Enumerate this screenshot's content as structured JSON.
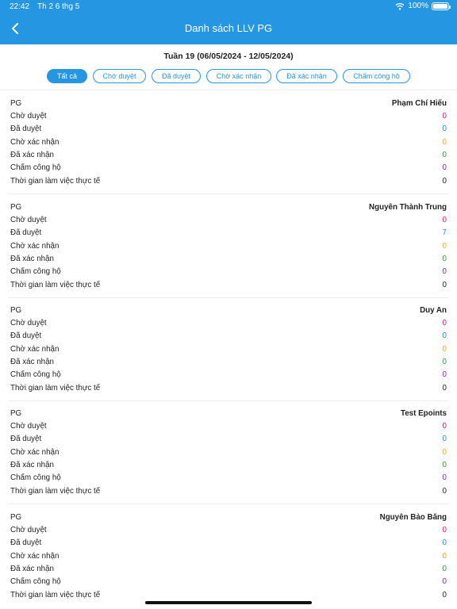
{
  "status_bar": {
    "time": "22:42",
    "date": "Th 2 6 thg 5",
    "battery": "100%"
  },
  "header": {
    "title": "Danh sách LLV PG",
    "back_icon": "chevron-left-icon"
  },
  "week": "Tuần 19 (06/05/2024 - 12/05/2024)",
  "tabs": [
    {
      "label": "Tất cả",
      "active": true
    },
    {
      "label": "Chờ duyệt",
      "active": false
    },
    {
      "label": "Đã duyệt",
      "active": false
    },
    {
      "label": "Chờ xác nhận",
      "active": false
    },
    {
      "label": "Đã xác nhận",
      "active": false
    },
    {
      "label": "Chấm công hộ",
      "active": false
    }
  ],
  "labels": {
    "pg": "PG",
    "pending": "Chờ duyệt",
    "approved": "Đã duyệt",
    "awaiting_confirm": "Chờ xác nhận",
    "confirmed": "Đã xác nhận",
    "proxy_attendance": "Chấm công hộ",
    "actual_time": "Thời gian làm việc thực tế"
  },
  "colors": {
    "accent": "#2596e1",
    "pending": "#e0245e",
    "approved": "#2596e1",
    "awaiting_confirm": "#f5a623",
    "confirmed": "#2e9e44",
    "proxy_attendance": "#9b27b0",
    "actual_time": "#222222"
  },
  "cards": [
    {
      "name": "Phạm Chí Hiếu",
      "pending": "0",
      "approved": "0",
      "awaiting_confirm": "0",
      "confirmed": "0",
      "proxy_attendance": "0",
      "actual_time": "0"
    },
    {
      "name": "Nguyên Thành Trung",
      "pending": "0",
      "approved": "7",
      "awaiting_confirm": "0",
      "confirmed": "0",
      "proxy_attendance": "0",
      "actual_time": "0"
    },
    {
      "name": "Duy An",
      "pending": "0",
      "approved": "0",
      "awaiting_confirm": "0",
      "confirmed": "0",
      "proxy_attendance": "0",
      "actual_time": "0"
    },
    {
      "name": "Test Epoints",
      "pending": "0",
      "approved": "0",
      "awaiting_confirm": "0",
      "confirmed": "0",
      "proxy_attendance": "0",
      "actual_time": "0"
    },
    {
      "name": "Nguyên Bảo Băng",
      "pending": "0",
      "approved": "0",
      "awaiting_confirm": "0",
      "confirmed": "0",
      "proxy_attendance": "0",
      "actual_time": "0"
    }
  ]
}
